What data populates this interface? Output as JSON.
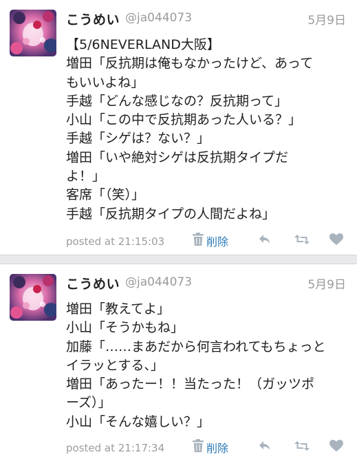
{
  "tweets": [
    {
      "name": "こうめい",
      "handle": "@ja044073",
      "date": "5月9日",
      "lines": [
        "【5/6NEVERLAND大阪】",
        "増田「反抗期は俺もなかったけど、あって",
        "もいいよね」",
        "手越「どんな感じなの？反抗期って」",
        "小山「この中で反抗期あった人いる？」",
        "手越「シゲは？ない？」",
        "増田「いや絶対シゲは反抗期タイプだ",
        "よ！」",
        "客席「（笑）」",
        "手越「反抗期タイプの人間だよね」"
      ],
      "posted": "posted at 21:15:03",
      "delete_label": "削除"
    },
    {
      "name": "こうめい",
      "handle": "@ja044073",
      "date": "5月9日",
      "lines": [
        "増田「教えてよ」",
        "小山「そうかもね」",
        "加藤「……まあだから何言われてもちょっと",
        "イラッとする、」",
        "増田「あったー！！当たった！（ガッツポ",
        "ーズ）」",
        "小山「そんな嬉しい？」"
      ],
      "posted": "posted at 21:17:34",
      "delete_label": "削除"
    }
  ],
  "icons": {
    "avatar": "avatar-image",
    "trash": "trash-icon",
    "reply": "reply-icon",
    "retweet": "retweet-icon",
    "favorite": "heart-icon"
  },
  "colors": {
    "link": "#2b7bb9",
    "meta": "#9a9a9a",
    "icon": "#a9b3bd",
    "text": "#1f1f1f"
  }
}
